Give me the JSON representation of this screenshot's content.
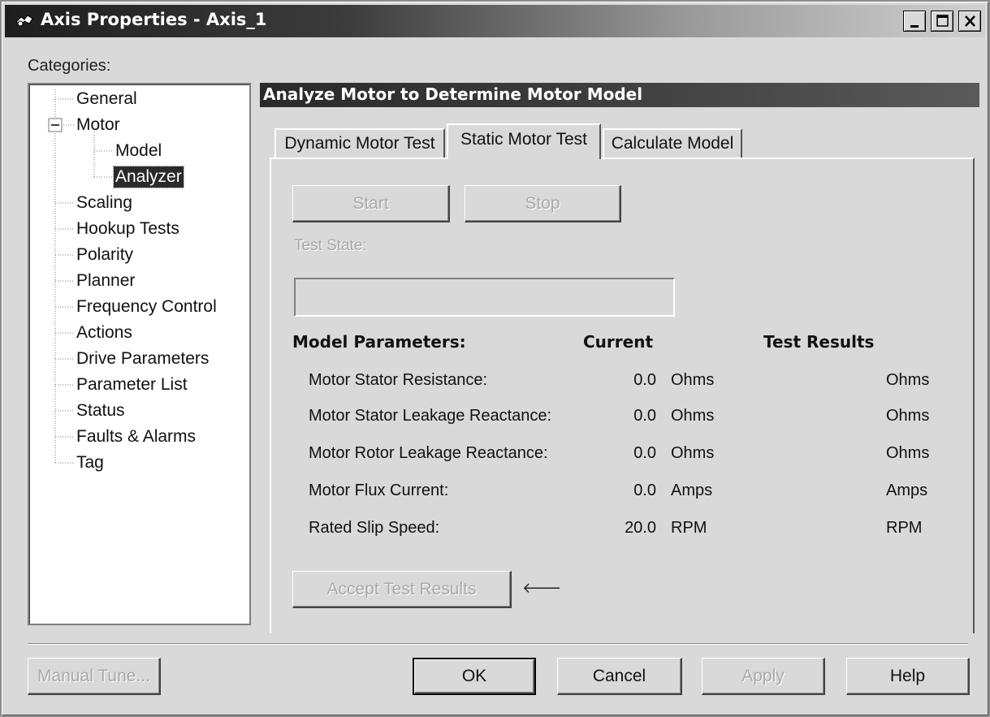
{
  "window": {
    "title": "Axis Properties - Axis_1",
    "controls": [
      "minimize-icon",
      "maximize-icon",
      "close-icon"
    ]
  },
  "categories": {
    "label": "Categories:",
    "items": [
      {
        "label": "General"
      },
      {
        "label": "Motor"
      },
      {
        "label": "Model"
      },
      {
        "label": "Analyzer"
      },
      {
        "label": "Scaling"
      },
      {
        "label": "Hookup Tests"
      },
      {
        "label": "Polarity"
      },
      {
        "label": "Planner"
      },
      {
        "label": "Frequency Control"
      },
      {
        "label": "Actions"
      },
      {
        "label": "Drive Parameters"
      },
      {
        "label": "Parameter List"
      },
      {
        "label": "Status"
      },
      {
        "label": "Faults & Alarms"
      },
      {
        "label": "Tag"
      }
    ],
    "selected": "Analyzer"
  },
  "section": {
    "title": "Analyze Motor to Determine Motor Model"
  },
  "tabs": [
    {
      "label": "Dynamic Motor Test"
    },
    {
      "label": "Static Motor Test"
    },
    {
      "label": "Calculate Model"
    }
  ],
  "active_tab": "Static Motor Test",
  "panel": {
    "start_label": "Start",
    "stop_label": "Stop",
    "test_state_label": "Test State:",
    "test_state_value": "",
    "headers": {
      "params": "Model Parameters:",
      "current": "Current",
      "results": "Test Results"
    },
    "rows": [
      {
        "name": "Motor Stator Resistance:",
        "value": "0.0",
        "unit": "Ohms",
        "result_unit": "Ohms"
      },
      {
        "name": "Motor Stator Leakage Reactance:",
        "value": "0.0",
        "unit": "Ohms",
        "result_unit": "Ohms"
      },
      {
        "name": "Motor Rotor Leakage Reactance:",
        "value": "0.0",
        "unit": "Ohms",
        "result_unit": "Ohms"
      },
      {
        "name": "Motor Flux Current:",
        "value": "0.0",
        "unit": "Amps",
        "result_unit": "Amps"
      },
      {
        "name": "Rated Slip Speed:",
        "value": "20.0",
        "unit": "RPM",
        "result_unit": "RPM"
      }
    ],
    "accept_label": "Accept Test Results",
    "arrow_glyph": "🡐"
  },
  "footer": {
    "manual_tune": "Manual Tune...",
    "ok": "OK",
    "cancel": "Cancel",
    "apply": "Apply",
    "help": "Help"
  }
}
